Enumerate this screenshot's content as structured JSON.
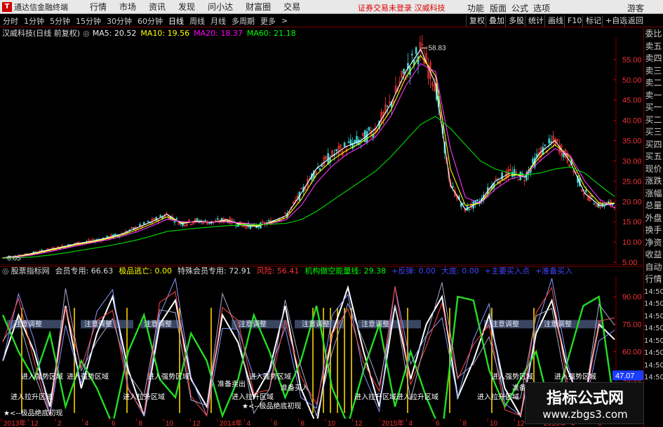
{
  "window": {
    "title": "通达信金融终端",
    "logo": "T"
  },
  "menu": [
    "行情",
    "市场",
    "资讯",
    "发现",
    "问小达",
    "财富圈",
    "交易"
  ],
  "security_alert": "证券交易未登录   汉威科技",
  "right_menu": [
    "功能",
    "版面",
    "公式",
    "选项",
    "游客"
  ],
  "periods": [
    "分时",
    "1分钟",
    "5分钟",
    "15分钟",
    "30分钟",
    "60分钟",
    "日线",
    "周线",
    "月线",
    "多周期",
    "更多"
  ],
  "active_period": "日线",
  "toolbar_buttons": [
    "复权",
    "叠加",
    "多股",
    "统计",
    "画线",
    "F10",
    "标记",
    "+自选",
    "返回"
  ],
  "stock": {
    "name": "汉威科技(日线 前复权)",
    "ma5": "MA5: 20.52",
    "ma10": "MA10: 19.56",
    "ma20": "MA20: 18.37",
    "ma60": "MA60: 21.18",
    "high_label": "58.83",
    "low_label": "6.05"
  },
  "indicator": {
    "name": "股票指标网",
    "member": "会员专用: 66.63",
    "escape": "极品逃亡: 0.00",
    "special": "特殊会员专用: 72.91",
    "risk": "风险: 56.41",
    "inst": "机构做空能量线: 29.38",
    "extra1": "+反弹: 0.00",
    "extra2": "大底: 0.00",
    "extra3": "+主要买入点",
    "extra4": "+准备买入",
    "current_value": "47.07",
    "annotations": [
      "注意调整",
      "注意调整",
      "注意调整",
      "注意调整",
      "注意调整",
      "注意调整",
      "注意调整",
      "注意调整",
      "进入强势区域",
      "进入强势区域",
      "进入强势区域",
      "进入强势区域",
      "进入强势区域",
      "进入强势区域",
      "进入拉升区域",
      "进入拉升区域",
      "进入拉升区域",
      "进入拉升区域",
      "进入拉升区域",
      "进入拉升区域",
      "★<--极品绝底初现",
      "★<--极品绝底初现",
      "准备卖出",
      "准备买入",
      "准备买入"
    ]
  },
  "right_panel": [
    "委比",
    "卖五",
    "卖四",
    "卖三",
    "卖二",
    "卖一",
    "买一",
    "买二",
    "买三",
    "买四",
    "买五",
    "现价",
    "涨跌",
    "涨幅",
    "总量",
    "外盘",
    "换手",
    "净资",
    "收益",
    "自动",
    "行情",
    "14:50",
    "14:50",
    "14:50",
    "14:50",
    "14:50",
    "14:50",
    "14:50",
    "14:50"
  ],
  "chart_data": [
    {
      "type": "line",
      "title": "汉威科技(日线 前复权)",
      "xlabel": "",
      "ylabel": "",
      "x": [
        "2013-01",
        "2013-02",
        "2013-03",
        "2013-04",
        "2013-05",
        "2013-06",
        "2013-07",
        "2013-08",
        "2013-09",
        "2013-10",
        "2013-11",
        "2013-12",
        "2014-01",
        "2014-02",
        "2014-03",
        "2014-04",
        "2014-05",
        "2014-06",
        "2014-07",
        "2014-08",
        "2014-09",
        "2014-10",
        "2014-11",
        "2014-12",
        "2015-01",
        "2015-02",
        "2015-03",
        "2015-04",
        "2015-05",
        "2015-06",
        "2015-07",
        "2015-08",
        "2015-09",
        "2015-10",
        "2015-11",
        "2015-12",
        "2016-01",
        "2016-02",
        "2016-03",
        "2016-04",
        "2016-05",
        "2016-06"
      ],
      "series": [
        {
          "name": "MA5",
          "values": [
            6.1,
            6.5,
            7.2,
            8.0,
            8.8,
            9.6,
            10.2,
            11.0,
            12.0,
            13.5,
            15.0,
            16.8,
            14.5,
            15.2,
            14.8,
            15.5,
            14.2,
            13.8,
            15.0,
            16.5,
            22.0,
            28.0,
            31.0,
            33.5,
            35.0,
            38.0,
            44.0,
            52.0,
            57.5,
            49.0,
            24.0,
            18.0,
            20.0,
            25.0,
            27.0,
            26.0,
            32.0,
            35.0,
            30.0,
            22.0,
            19.0,
            19.5
          ]
        },
        {
          "name": "MA10",
          "values": [
            6.0,
            6.4,
            7.0,
            7.8,
            8.6,
            9.4,
            10.0,
            10.8,
            11.7,
            13.0,
            14.5,
            16.2,
            14.8,
            15.0,
            14.9,
            15.2,
            14.5,
            14.0,
            14.8,
            16.0,
            20.5,
            26.5,
            30.0,
            32.5,
            34.5,
            37.0,
            42.5,
            50.5,
            56.0,
            51.0,
            28.0,
            19.0,
            19.5,
            24.0,
            26.5,
            26.5,
            31.0,
            34.0,
            31.0,
            23.5,
            19.5,
            19.6
          ]
        },
        {
          "name": "MA20",
          "values": [
            6.0,
            6.3,
            6.8,
            7.5,
            8.3,
            9.1,
            9.8,
            10.5,
            11.4,
            12.5,
            14.0,
            15.6,
            15.0,
            14.9,
            14.9,
            15.0,
            14.7,
            14.3,
            14.6,
            15.5,
            19.0,
            24.5,
            28.5,
            31.5,
            33.5,
            36.0,
            41.0,
            48.5,
            54.0,
            52.0,
            33.0,
            21.0,
            19.5,
            23.0,
            25.5,
            26.5,
            30.0,
            33.0,
            31.5,
            25.0,
            20.5,
            18.4
          ]
        },
        {
          "name": "MA60",
          "values": [
            6.0,
            6.1,
            6.3,
            6.7,
            7.2,
            7.8,
            8.4,
            9.0,
            9.7,
            10.5,
            11.5,
            12.6,
            13.0,
            13.4,
            13.7,
            14.0,
            14.2,
            14.3,
            14.4,
            14.6,
            15.5,
            17.5,
            20.0,
            22.5,
            25.0,
            27.5,
            31.0,
            35.0,
            39.0,
            41.0,
            38.0,
            34.0,
            30.0,
            28.0,
            27.0,
            26.5,
            27.0,
            28.0,
            28.5,
            27.0,
            24.0,
            21.2
          ]
        }
      ],
      "ylim": [
        5,
        60
      ],
      "yticks": [
        "55.00",
        "50.00",
        "45.00",
        "40.00",
        "35.00",
        "30.00",
        "25.00",
        "20.00",
        "15.00",
        "10.00",
        "5.00"
      ]
    },
    {
      "type": "line",
      "title": "股票指标网",
      "xlabel": "",
      "ylabel": "",
      "x": [
        0,
        1,
        2,
        3,
        4,
        5,
        6,
        7,
        8,
        9,
        10,
        11,
        12,
        13,
        14,
        15,
        16,
        17,
        18,
        19,
        20,
        21,
        22,
        23,
        24,
        25,
        26,
        27,
        28,
        29,
        30,
        31,
        32,
        33,
        34,
        35,
        36,
        37,
        38,
        39
      ],
      "series": [
        {
          "name": "会员专用",
          "values": [
            55,
            80,
            60,
            30,
            85,
            40,
            70,
            90,
            50,
            25,
            75,
            88,
            45,
            30,
            80,
            65,
            35,
            50,
            85,
            40,
            20,
            70,
            95,
            60,
            30,
            85,
            45,
            75,
            90,
            35,
            55,
            80,
            40,
            25,
            70,
            88,
            50,
            30,
            75,
            66.63
          ]
        },
        {
          "name": "机构做空能量线",
          "values": [
            80,
            60,
            45,
            70,
            30,
            55,
            40,
            20,
            60,
            80,
            45,
            35,
            70,
            55,
            25,
            45,
            80,
            60,
            35,
            55,
            85,
            40,
            20,
            50,
            75,
            30,
            60,
            35,
            15,
            90,
            88,
            50,
            30,
            45,
            60,
            25,
            55,
            85,
            90,
            29.38
          ]
        }
      ],
      "ylim": [
        25,
        100
      ],
      "yticks": [
        "90.00",
        "75.00",
        "60.00",
        "45.00"
      ]
    }
  ],
  "xaxis_labels": [
    "2013年",
    "12",
    "2",
    "4",
    "6",
    "8",
    "10",
    "12",
    "2014年",
    "4",
    "6",
    "8",
    "10",
    "12",
    "2015年",
    "4",
    "6",
    "8",
    "10",
    "12",
    "2016年",
    "4",
    "6"
  ],
  "watermark": {
    "title": "指标公式网",
    "url": "www.zbgs3.com"
  }
}
